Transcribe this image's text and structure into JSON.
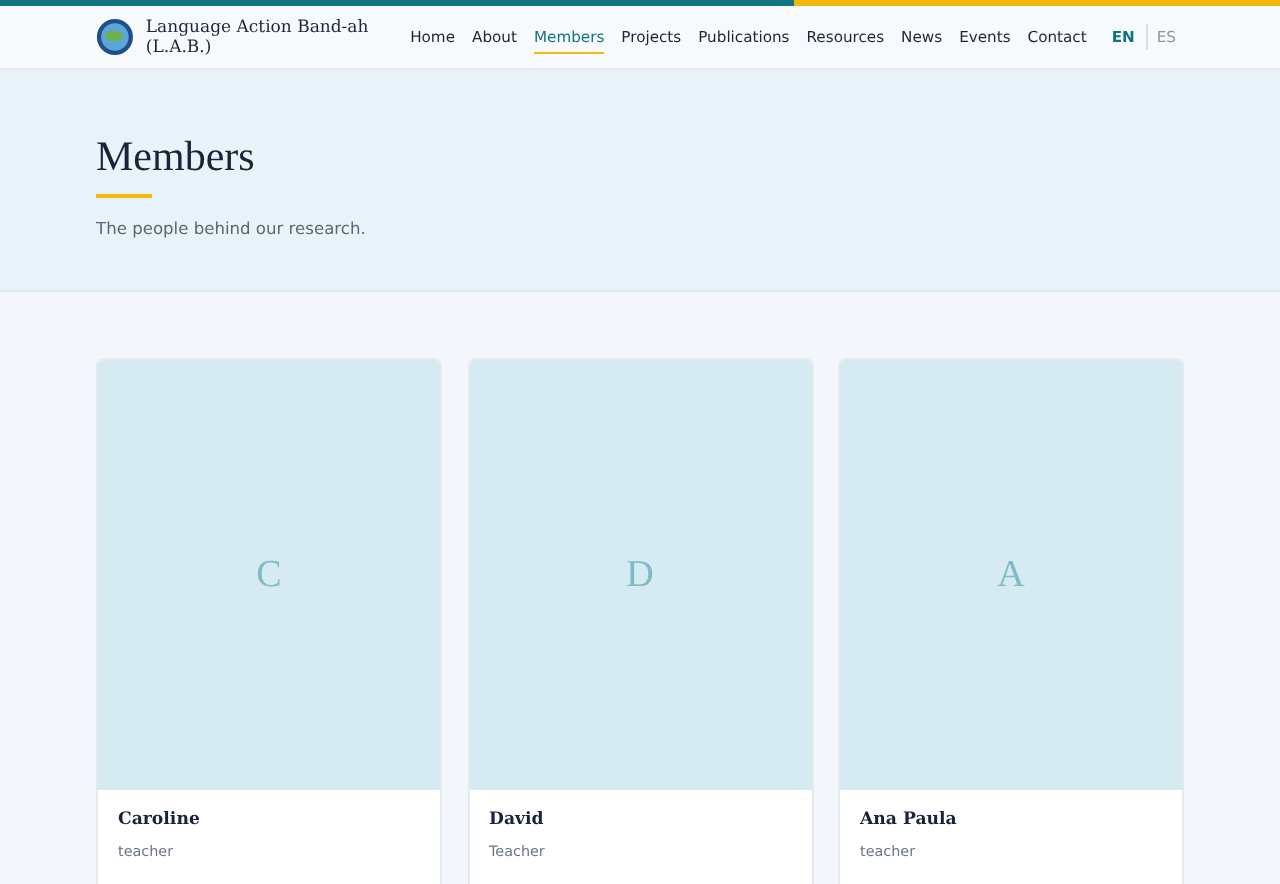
{
  "site": {
    "title": "Language Action Band-ah (L.A.B.)"
  },
  "nav": [
    {
      "label": "Home",
      "selected": false
    },
    {
      "label": "About",
      "selected": false
    },
    {
      "label": "Members",
      "selected": true
    },
    {
      "label": "Projects",
      "selected": false
    },
    {
      "label": "Publications",
      "selected": false
    },
    {
      "label": "Resources",
      "selected": false
    },
    {
      "label": "News",
      "selected": false
    },
    {
      "label": "Events",
      "selected": false
    },
    {
      "label": "Contact",
      "selected": false
    }
  ],
  "languages": [
    {
      "label": "EN",
      "selected": true
    },
    {
      "label": "ES",
      "selected": false
    }
  ],
  "hero": {
    "title": "Members",
    "subtitle": "The people behind our research."
  },
  "members": [
    {
      "initial": "C",
      "name": "Caroline",
      "role": "teacher"
    },
    {
      "initial": "D",
      "name": "David",
      "role": "Teacher"
    },
    {
      "initial": "A",
      "name": "Ana Paula",
      "role": "teacher"
    }
  ]
}
